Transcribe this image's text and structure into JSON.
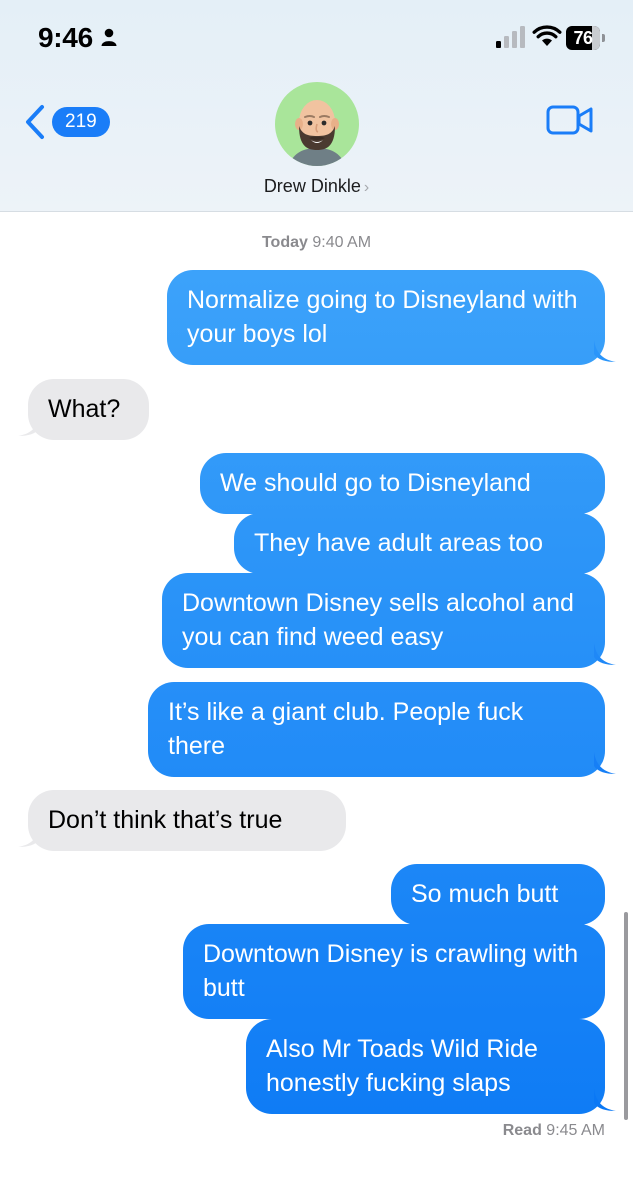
{
  "status_bar": {
    "time": "9:46",
    "battery": "76",
    "battery_level": 0.76
  },
  "header": {
    "back_count": "219",
    "contact_name": "Drew Dinkle",
    "chevron": "›"
  },
  "conversation": {
    "timestamp_day": "Today",
    "timestamp_time": "9:40 AM",
    "read_label": "Read",
    "read_time": "9:45 AM"
  },
  "messages": [
    {
      "from": "me",
      "text": "Normalize going to Disneyland with your boys lol"
    },
    {
      "from": "them",
      "text": "What?"
    },
    {
      "from": "me",
      "text": "We should go to Disneyland"
    },
    {
      "from": "me",
      "text": "They have adult areas too"
    },
    {
      "from": "me",
      "text": "Downtown Disney sells alcohol and you can find weed easy"
    },
    {
      "from": "me",
      "text": "It’s like a giant club. People fuck there"
    },
    {
      "from": "them",
      "text": "Don’t think that’s true"
    },
    {
      "from": "me",
      "text": "So much butt"
    },
    {
      "from": "me",
      "text": "Downtown Disney is crawling with butt"
    },
    {
      "from": "me",
      "text": "Also Mr Toads Wild Ride honestly fucking slaps"
    }
  ],
  "colors": {
    "sent_top": "#4aaefb",
    "sent_bottom": "#0a78f5",
    "received": "#e9e9eb",
    "accent": "#1a7df8"
  },
  "icons": {
    "back": "chevron-left-icon",
    "video": "video-camera-icon",
    "avatar": "memoji-avatar",
    "signal": "cellular-signal-icon",
    "wifi": "wifi-icon",
    "battery": "battery-icon",
    "person": "person-icon"
  }
}
